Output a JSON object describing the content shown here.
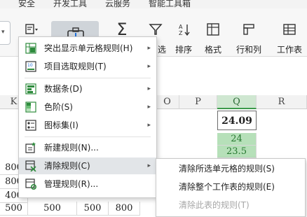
{
  "ribbon_tabs": [
    "安全",
    "开发工具",
    "云服务",
    "智能工具箱"
  ],
  "toolbar": {
    "filter_suffix": "选",
    "sort": "排序",
    "format": "格式",
    "row_col": "行和列",
    "worksheet": "工作表"
  },
  "columns": [
    "K",
    "O",
    "P",
    "Q",
    "R"
  ],
  "cells": {
    "q_value_1": "24.09",
    "q_value_2": "24",
    "q_value_3": "23.5",
    "left_col": [
      "800",
      "800",
      "400",
      "500",
      "500"
    ],
    "col_b": [
      "500"
    ],
    "col_c": [
      "500"
    ],
    "col_d": [
      "800"
    ]
  },
  "menu": {
    "items": [
      {
        "label": "突出显示单元格规则(H)",
        "has_submenu": true
      },
      {
        "label": "项目选取规则(T)",
        "has_submenu": true
      },
      {
        "label": "数据条(D)",
        "has_submenu": true
      },
      {
        "label": "色阶(S)",
        "has_submenu": true
      },
      {
        "label": "图标集(I)",
        "has_submenu": true
      },
      {
        "label": "新建规则(N)...",
        "has_submenu": false
      },
      {
        "label": "清除规则(C)",
        "has_submenu": true,
        "active": true
      },
      {
        "label": "管理规则(R)...",
        "has_submenu": false
      }
    ]
  },
  "submenu": {
    "items": [
      {
        "label": "清除所选单元格的规则(S)",
        "enabled": true
      },
      {
        "label": "清除整个工作表的规则(E)",
        "enabled": true
      },
      {
        "label": "清除此表的规则(T)",
        "enabled": false
      }
    ]
  },
  "colors": {
    "menu_active_bg": "#e2e5e8",
    "selected_col_bg": "#cfe7d1",
    "green_cell_bg": "#b6e0b9",
    "icon_green": "#2e8b3d"
  }
}
